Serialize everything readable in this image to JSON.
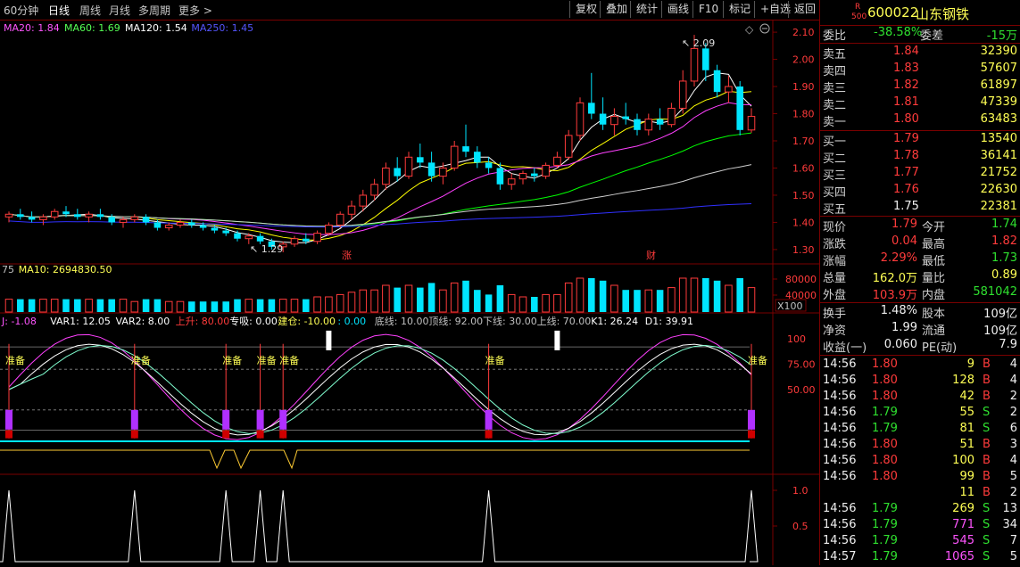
{
  "toolbar": {
    "tabs": [
      "60分钟",
      "日线",
      "周线",
      "月线",
      "多周期",
      "更多"
    ],
    "active_tab": "日线",
    "buttons": [
      "复权",
      "叠加",
      "统计",
      "画线",
      "F10",
      "标记",
      "+自选",
      "返回"
    ]
  },
  "colors": {
    "up": "#ff3b3b",
    "down": "#00e5ff",
    "ma20": "#ffffff",
    "ma60": "#ffff00",
    "ma120": "#ff40ff",
    "ma250": "#00ff00",
    "grid_red": "#7a0000"
  },
  "price_panel": {
    "legend": [
      {
        "text": "MA20: 1.84",
        "color": "#ff55ff"
      },
      {
        "text": "MA60: 1.69",
        "color": "#55ff55"
      },
      {
        "text": "MA120: 1.54",
        "color": "#ffffff"
      },
      {
        "text": "MA250: 1.45",
        "color": "#5555ff"
      }
    ],
    "y_ticks": [
      "2.10",
      "2.00",
      "1.90",
      "1.80",
      "1.70",
      "1.60",
      "1.50",
      "1.40",
      "1.30"
    ],
    "high_label": "2.09",
    "low_label": "1.29",
    "marker_up": "涨",
    "marker_cai": "财"
  },
  "volume_panel": {
    "legend": [
      {
        "text": "75",
        "color": "#c0c0c0"
      },
      {
        "text": "MA10: 2694830.50",
        "color": "#ffff55"
      }
    ],
    "y_ticks": [
      "80000",
      "40000"
    ],
    "unit": "X100"
  },
  "indicator_panel": {
    "legend": [
      {
        "text": "J: -1.08",
        "color": "#ff55ff"
      },
      {
        "text": "VAR1: 12.05",
        "color": "#ffffff"
      },
      {
        "text": "VAR2: 8.00",
        "color": "#ffffff"
      },
      {
        "text": "上升: 80.00",
        "color": "#ff3b3b"
      },
      {
        "text": "专吸: 0.00",
        "color": "#ffffff"
      },
      {
        "text": "建仓: -10.00",
        "color": "#ffff55"
      },
      {
        "text": ": 0.00",
        "color": "#00e5ff"
      },
      {
        "text": "底线: 10.00",
        "color": "#c0c0c0"
      },
      {
        "text": "顶线: 92.00",
        "color": "#c0c0c0"
      },
      {
        "text": "下线: 30.00",
        "color": "#c0c0c0"
      },
      {
        "text": "上线: 70.00",
        "color": "#c0c0c0"
      },
      {
        "text": "K1: 26.24",
        "color": "#ffffff"
      },
      {
        "text": "D1: 39.91",
        "color": "#ffffff"
      }
    ],
    "y_ticks": [
      "100",
      "75.00",
      "50.00"
    ],
    "signal_label": "准备"
  },
  "bottom_panel": {
    "y_ticks": [
      "1.0",
      "0.5"
    ]
  },
  "quote": {
    "code": "600022",
    "name": "山东钢铁",
    "badge_top": "R",
    "badge_bottom": "500",
    "weibi_label": "委比",
    "weibi": "-38.58%",
    "weicha_label": "委差",
    "weicha": "-15万",
    "asks": [
      {
        "label": "卖五",
        "price": "1.84",
        "vol": "32390"
      },
      {
        "label": "卖四",
        "price": "1.83",
        "vol": "57607"
      },
      {
        "label": "卖三",
        "price": "1.82",
        "vol": "61897"
      },
      {
        "label": "卖二",
        "price": "1.81",
        "vol": "47339"
      },
      {
        "label": "卖一",
        "price": "1.80",
        "vol": "63483"
      }
    ],
    "bids": [
      {
        "label": "买一",
        "price": "1.79",
        "vol": "13540"
      },
      {
        "label": "买二",
        "price": "1.78",
        "vol": "36141"
      },
      {
        "label": "买三",
        "price": "1.77",
        "vol": "21752"
      },
      {
        "label": "买四",
        "price": "1.76",
        "vol": "22630"
      },
      {
        "label": "买五",
        "price": "1.75",
        "vol": "22381"
      }
    ],
    "stats": [
      {
        "l1": "现价",
        "v1": "1.79",
        "l2": "今开",
        "v2": "1.74"
      },
      {
        "l1": "涨跌",
        "v1": "0.04",
        "l2": "最高",
        "v2": "1.82"
      },
      {
        "l1": "涨幅",
        "v1": "2.29%",
        "l2": "最低",
        "v2": "1.73"
      },
      {
        "l1": "总量",
        "v1": "162.0万",
        "l2": "量比",
        "v2": "0.89"
      },
      {
        "l1": "外盘",
        "v1": "103.9万",
        "l2": "内盘",
        "v2": "581042"
      }
    ],
    "fund": [
      {
        "l1": "换手",
        "v1": "1.48%",
        "l2": "股本",
        "v2": "109亿"
      },
      {
        "l1": "净资",
        "v1": "1.99",
        "l2": "流通",
        "v2": "109亿"
      },
      {
        "l1": "收益(一)",
        "v1": "0.060",
        "l2": "PE(动)",
        "v2": "7.9"
      }
    ],
    "ticks": [
      {
        "time": "14:56",
        "price": "1.80",
        "vol": "9",
        "side": "B",
        "n": "4"
      },
      {
        "time": "14:56",
        "price": "1.80",
        "vol": "128",
        "side": "B",
        "n": "4"
      },
      {
        "time": "14:56",
        "price": "1.80",
        "vol": "42",
        "side": "B",
        "n": "2"
      },
      {
        "time": "14:56",
        "price": "1.79",
        "vol": "55",
        "side": "S",
        "n": "2"
      },
      {
        "time": "14:56",
        "price": "1.79",
        "vol": "81",
        "side": "S",
        "n": "6"
      },
      {
        "time": "14:56",
        "price": "1.80",
        "vol": "51",
        "side": "B",
        "n": "3"
      },
      {
        "time": "14:56",
        "price": "1.80",
        "vol": "100",
        "side": "B",
        "n": "4"
      },
      {
        "time": "14:56",
        "price": "1.80",
        "vol": "99",
        "side": "B",
        "n": "5"
      },
      {
        "time": "",
        "price": "",
        "vol": "11",
        "side": "B",
        "n": "2"
      },
      {
        "time": "14:56",
        "price": "1.79",
        "vol": "269",
        "side": "S",
        "n": "13"
      },
      {
        "time": "14:56",
        "price": "1.79",
        "vol": "771",
        "side": "S",
        "n": "34"
      },
      {
        "time": "14:56",
        "price": "1.79",
        "vol": "545",
        "side": "S",
        "n": "7"
      },
      {
        "time": "14:57",
        "price": "1.79",
        "vol": "1065",
        "side": "S",
        "n": "5"
      }
    ]
  },
  "chart_data": {
    "type": "candlestick",
    "period": "日线",
    "price_axis": [
      1.28,
      2.12
    ],
    "ohlc": [
      [
        1.42,
        1.44,
        1.4,
        1.43
      ],
      [
        1.43,
        1.45,
        1.41,
        1.42
      ],
      [
        1.42,
        1.44,
        1.4,
        1.41
      ],
      [
        1.41,
        1.43,
        1.39,
        1.42
      ],
      [
        1.42,
        1.45,
        1.41,
        1.44
      ],
      [
        1.44,
        1.46,
        1.42,
        1.43
      ],
      [
        1.43,
        1.45,
        1.41,
        1.42
      ],
      [
        1.42,
        1.44,
        1.4,
        1.43
      ],
      [
        1.43,
        1.45,
        1.41,
        1.42
      ],
      [
        1.42,
        1.43,
        1.39,
        1.4
      ],
      [
        1.4,
        1.42,
        1.38,
        1.41
      ],
      [
        1.41,
        1.43,
        1.4,
        1.42
      ],
      [
        1.42,
        1.43,
        1.39,
        1.4
      ],
      [
        1.4,
        1.41,
        1.37,
        1.38
      ],
      [
        1.38,
        1.4,
        1.37,
        1.39
      ],
      [
        1.39,
        1.41,
        1.38,
        1.4
      ],
      [
        1.4,
        1.41,
        1.38,
        1.39
      ],
      [
        1.39,
        1.4,
        1.37,
        1.38
      ],
      [
        1.38,
        1.39,
        1.36,
        1.37
      ],
      [
        1.37,
        1.38,
        1.35,
        1.36
      ],
      [
        1.36,
        1.37,
        1.33,
        1.34
      ],
      [
        1.34,
        1.36,
        1.32,
        1.35
      ],
      [
        1.35,
        1.36,
        1.32,
        1.33
      ],
      [
        1.33,
        1.34,
        1.3,
        1.31
      ],
      [
        1.31,
        1.33,
        1.29,
        1.32
      ],
      [
        1.32,
        1.35,
        1.31,
        1.34
      ],
      [
        1.34,
        1.36,
        1.32,
        1.33
      ],
      [
        1.33,
        1.37,
        1.32,
        1.36
      ],
      [
        1.36,
        1.4,
        1.35,
        1.39
      ],
      [
        1.39,
        1.44,
        1.38,
        1.43
      ],
      [
        1.43,
        1.48,
        1.41,
        1.46
      ],
      [
        1.46,
        1.52,
        1.44,
        1.5
      ],
      [
        1.5,
        1.56,
        1.48,
        1.54
      ],
      [
        1.54,
        1.62,
        1.52,
        1.6
      ],
      [
        1.6,
        1.64,
        1.55,
        1.57
      ],
      [
        1.57,
        1.66,
        1.56,
        1.64
      ],
      [
        1.64,
        1.69,
        1.6,
        1.62
      ],
      [
        1.62,
        1.66,
        1.55,
        1.57
      ],
      [
        1.57,
        1.62,
        1.54,
        1.6
      ],
      [
        1.6,
        1.7,
        1.59,
        1.68
      ],
      [
        1.68,
        1.76,
        1.64,
        1.66
      ],
      [
        1.66,
        1.68,
        1.6,
        1.62
      ],
      [
        1.62,
        1.64,
        1.58,
        1.6
      ],
      [
        1.6,
        1.62,
        1.52,
        1.54
      ],
      [
        1.54,
        1.58,
        1.52,
        1.56
      ],
      [
        1.56,
        1.59,
        1.54,
        1.58
      ],
      [
        1.58,
        1.6,
        1.55,
        1.57
      ],
      [
        1.57,
        1.62,
        1.56,
        1.61
      ],
      [
        1.61,
        1.66,
        1.6,
        1.64
      ],
      [
        1.64,
        1.74,
        1.63,
        1.72
      ],
      [
        1.72,
        1.86,
        1.7,
        1.84
      ],
      [
        1.84,
        1.95,
        1.78,
        1.8
      ],
      [
        1.8,
        1.86,
        1.74,
        1.76
      ],
      [
        1.76,
        1.82,
        1.72,
        1.79
      ],
      [
        1.79,
        1.84,
        1.76,
        1.78
      ],
      [
        1.78,
        1.8,
        1.72,
        1.74
      ],
      [
        1.74,
        1.8,
        1.72,
        1.78
      ],
      [
        1.78,
        1.82,
        1.74,
        1.76
      ],
      [
        1.76,
        1.84,
        1.75,
        1.82
      ],
      [
        1.82,
        1.96,
        1.8,
        1.92
      ],
      [
        1.92,
        2.09,
        1.9,
        2.04
      ],
      [
        2.04,
        2.06,
        1.92,
        1.96
      ],
      [
        1.96,
        1.98,
        1.86,
        1.88
      ],
      [
        1.88,
        1.94,
        1.84,
        1.9
      ],
      [
        1.9,
        1.92,
        1.72,
        1.74
      ],
      [
        1.74,
        1.82,
        1.73,
        1.79
      ]
    ]
  }
}
